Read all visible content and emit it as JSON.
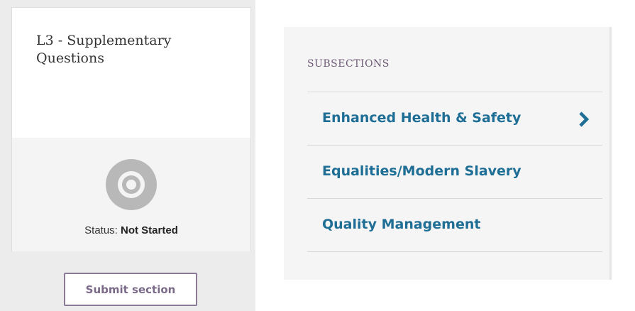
{
  "section_card": {
    "title": "L3 - Supplementary Questions",
    "status_label": "Status:",
    "status_value": "Not Started",
    "status_icon": "not-started-ring-icon",
    "submit_label": "Submit section"
  },
  "subsections": {
    "heading": "SUBSECTIONS",
    "items": [
      {
        "label": "Enhanced Health & Safety",
        "icon": "chevron-right-icon"
      },
      {
        "label": "Equalities/Modern Slavery"
      },
      {
        "label": "Quality Management"
      }
    ]
  },
  "colors": {
    "link_blue": "#1f6e96",
    "heading_purple": "#6e5a76",
    "button_border": "#8a7a96",
    "status_icon_gray": "#b8b8b8"
  }
}
